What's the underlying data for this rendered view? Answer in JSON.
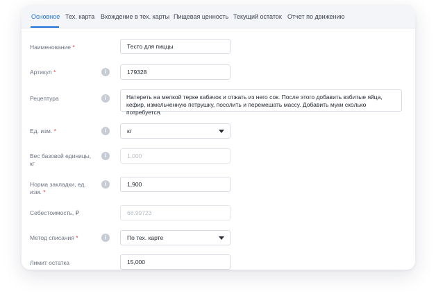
{
  "tabs": [
    {
      "label": "Основное"
    },
    {
      "label": "Тех. карта"
    },
    {
      "label": "Вхождение в тех. карты"
    },
    {
      "label": "Пищевая ценность"
    },
    {
      "label": "Текущий остаток"
    },
    {
      "label": "Отчет по движению"
    }
  ],
  "active_tab": "Основное",
  "accent_color": "#1e6fd9",
  "required_mark": "*",
  "info_icon_glyph": "i",
  "form": {
    "name": {
      "label": "Наименование",
      "value": "Тесто для пиццы"
    },
    "sku": {
      "label": "Артикул",
      "value": "179328"
    },
    "recipe": {
      "label": "Рецептура",
      "value": "Натереть на мелкой терке кабачок и отжать из него сок. После этого добавить взбитые яйца, кефир, измельченную петрушку, посолить и перемешать массу. Добавить муки сколько потребуется."
    },
    "unit": {
      "label": "Ед. изм.",
      "value": "кг"
    },
    "base_weight": {
      "label": "Вес базовой единицы, кг",
      "value": "1,000"
    },
    "portion_norm": {
      "label": "Норма закладки, ед. изм.",
      "value": "1,900"
    },
    "cost": {
      "label": "Себестоимость, ₽",
      "value": "68.99723"
    },
    "writeoff_method": {
      "label": "Метод списания",
      "value": "По тех. карте"
    },
    "stock_limit": {
      "label": "Лимит остатка",
      "value": "15,000"
    }
  }
}
